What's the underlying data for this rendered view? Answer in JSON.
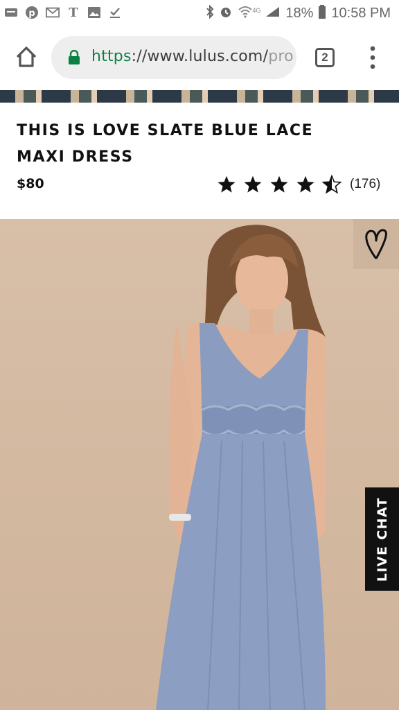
{
  "status_bar": {
    "left_icons": [
      "notification-icon",
      "pinterest-icon",
      "gmail-icon",
      "nytimes-icon",
      "image-icon",
      "download-done-icon"
    ],
    "network": "4G",
    "battery": "18%",
    "time": "10:58 PM"
  },
  "browser": {
    "url_scheme": "https",
    "url_rest": "://www.lulus.com/",
    "url_tail": "pro",
    "tab_count": "2"
  },
  "product": {
    "title": "THIS IS LOVE SLATE BLUE LACE MAXI DRESS",
    "price": "$80",
    "rating": 4.5,
    "review_count": "(176)"
  },
  "live_chat": "LIVE CHAT",
  "colors": {
    "https_green": "#0b8043",
    "photo_background": "#d8bfa8",
    "dress": "#8a9cc0"
  }
}
